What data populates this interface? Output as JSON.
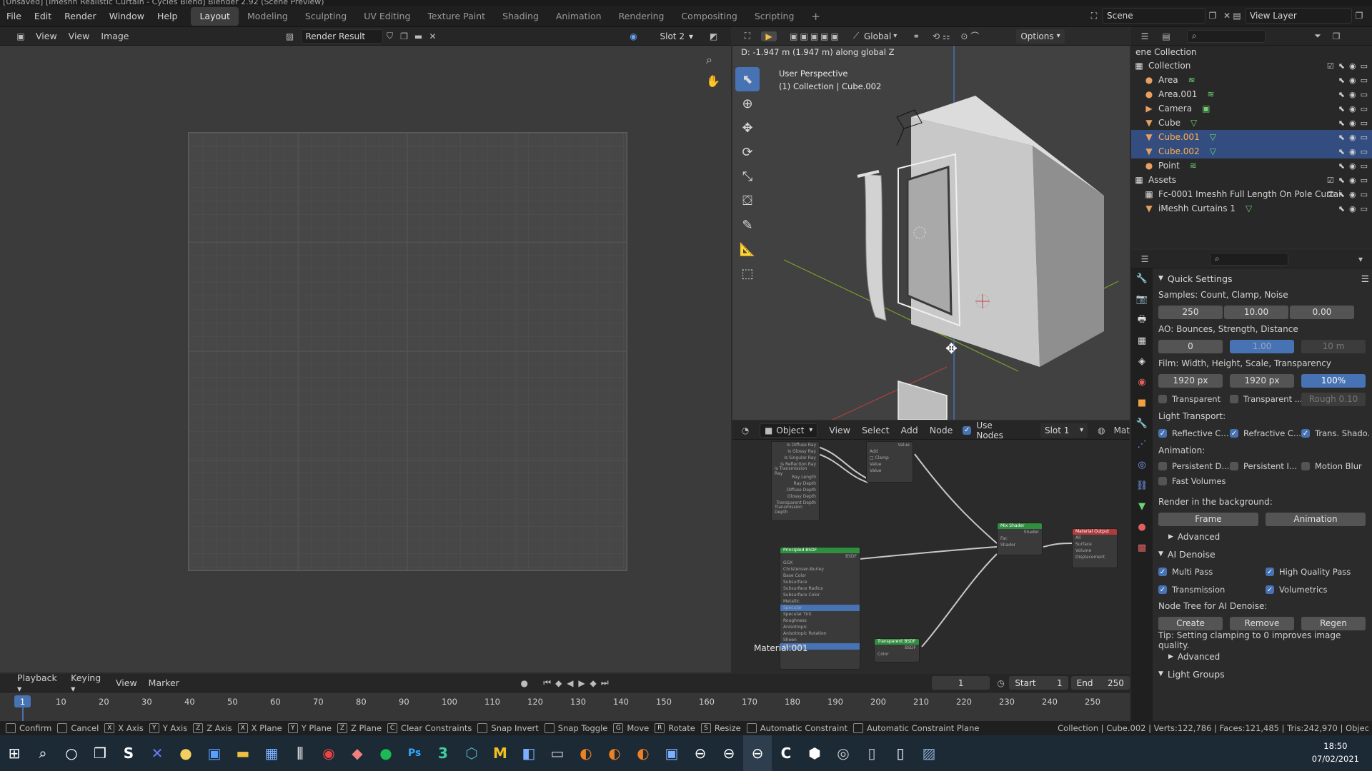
{
  "title_bar": {
    "text": "[Unsaved] [Imeshh Realistic Curtain - Cycles Blend] Blender 2.92 (Scene Preview)"
  },
  "menus": [
    "File",
    "Edit",
    "Render",
    "Window",
    "Help"
  ],
  "workspaces": [
    "Layout",
    "Modeling",
    "Sculpting",
    "UV Editing",
    "Texture Paint",
    "Shading",
    "Animation",
    "Rendering",
    "Compositing",
    "Scripting"
  ],
  "scene": {
    "scene_label": "Scene",
    "view_layer_label": "View Layer"
  },
  "image_editor": {
    "view": "View",
    "view2": "View",
    "image": "Image",
    "render_result": "Render Result",
    "slot": "Slot 2"
  },
  "viewport": {
    "transform_info": "D: -1.947 m (1.947 m) along global Z",
    "orientation": "Global",
    "options": "Options",
    "perspective": "User Perspective",
    "collection_info": "(1) Collection | Cube.002"
  },
  "node_editor": {
    "object": "Object",
    "view": "View",
    "select": "Select",
    "add": "Add",
    "node": "Node",
    "use_nodes": "Use Nodes",
    "slot": "Slot 1",
    "mat": "Mat",
    "material_label": "Material.001"
  },
  "outliner": {
    "header": "ene Collection",
    "items": [
      {
        "name": "Collection",
        "indent": 0,
        "icon": "collection"
      },
      {
        "name": "Area",
        "indent": 1,
        "icon": "light"
      },
      {
        "name": "Area.001",
        "indent": 1,
        "icon": "light"
      },
      {
        "name": "Camera",
        "indent": 1,
        "icon": "camera"
      },
      {
        "name": "Cube",
        "indent": 1,
        "icon": "mesh"
      },
      {
        "name": "Cube.001",
        "indent": 1,
        "icon": "mesh",
        "selected": true
      },
      {
        "name": "Cube.002",
        "indent": 1,
        "icon": "mesh",
        "selected": true
      },
      {
        "name": "Point",
        "indent": 1,
        "icon": "light"
      },
      {
        "name": "Assets",
        "indent": 0,
        "icon": "collection"
      },
      {
        "name": "Fc-0001 Imeshh Full Length On Pole Curtai",
        "indent": 1,
        "icon": "collection"
      },
      {
        "name": "iMeshh Curtains 1",
        "indent": 1,
        "icon": "mesh"
      }
    ]
  },
  "properties": {
    "quick_settings": "Quick Settings",
    "samples_label": "Samples: Count, Clamp, Noise",
    "samples": [
      "250",
      "10.00",
      "0.00"
    ],
    "ao_label": "AO: Bounces, Strength, Distance",
    "ao": [
      "0",
      "1.00",
      "10 m"
    ],
    "film_label": "Film: Width, Height, Scale, Transparency",
    "film": [
      "1920 px",
      "1920 px",
      "100%"
    ],
    "transparent": "Transparent",
    "transparent2": "Transparent ...",
    "rough": "Rough",
    "rough_val": "0.10",
    "light_transport": "Light Transport:",
    "reflective": "Reflective C...",
    "refractive": "Refractive C...",
    "trans_shadow": "Trans. Shado...",
    "animation": "Animation:",
    "persistent_d": "Persistent D...",
    "persistent_i": "Persistent I...",
    "motion_blur": "Motion Blur",
    "fast_volumes": "Fast Volumes",
    "render_bg": "Render in the background:",
    "frame": "Frame",
    "anim_btn": "Animation",
    "advanced": "Advanced",
    "ai_denoise": "AI Denoise",
    "multi_pass": "Multi Pass",
    "high_quality": "High Quality Pass",
    "transmission": "Transmission",
    "volumetrics": "Volumetrics",
    "node_tree": "Node Tree for AI Denoise:",
    "create": "Create",
    "remove": "Remove",
    "regen": "Regen",
    "tip": "Tip: Setting clamping to 0 improves image quality.",
    "advanced2": "Advanced",
    "light_groups": "Light Groups"
  },
  "timeline": {
    "playback": "Playback",
    "keying": "Keying",
    "view": "View",
    "marker": "Marker",
    "current_frame": "1",
    "start_label": "Start",
    "start": "1",
    "end_label": "End",
    "end": "250",
    "ticks": [
      "10",
      "20",
      "30",
      "40",
      "50",
      "60",
      "70",
      "80",
      "90",
      "100",
      "110",
      "120",
      "130",
      "140",
      "150",
      "160",
      "170",
      "180",
      "190",
      "200",
      "210",
      "220",
      "230",
      "240",
      "250"
    ],
    "frame_marker": "1"
  },
  "statusbar": {
    "items": [
      {
        "key": "",
        "label": "Confirm"
      },
      {
        "key": "",
        "label": "Cancel"
      },
      {
        "key": "X",
        "label": "X Axis"
      },
      {
        "key": "Y",
        "label": "Y Axis"
      },
      {
        "key": "Z",
        "label": "Z Axis"
      },
      {
        "key": "X",
        "label": "X Plane"
      },
      {
        "key": "Y",
        "label": "Y Plane"
      },
      {
        "key": "Z",
        "label": "Z Plane"
      },
      {
        "key": "C",
        "label": "Clear Constraints"
      },
      {
        "key": "",
        "label": "Snap Invert"
      },
      {
        "key": "",
        "label": "Snap Toggle"
      },
      {
        "key": "G",
        "label": "Move"
      },
      {
        "key": "R",
        "label": "Rotate"
      },
      {
        "key": "S",
        "label": "Resize"
      },
      {
        "key": "",
        "label": "Automatic Constraint"
      },
      {
        "key": "",
        "label": "Automatic Constraint Plane"
      }
    ],
    "stats": "Collection | Cube.002 | Verts:122,786 | Faces:121,485 | Tris:242,970 | Objec"
  },
  "taskbar": {
    "time": "18:50",
    "date": "07/02/2021"
  }
}
